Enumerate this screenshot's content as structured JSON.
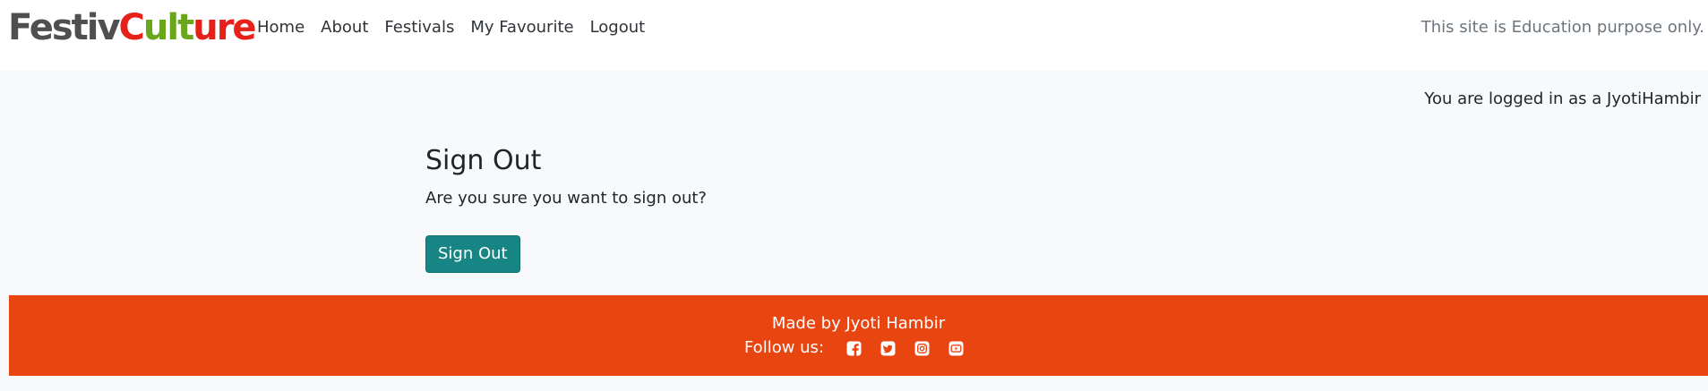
{
  "brand": {
    "part1": "Festiv",
    "part2": "C",
    "part3": "ult",
    "part4": "ure",
    "colors": {
      "dark": "#4f4f4f",
      "red": "#e8201a",
      "green": "#6aa61c"
    }
  },
  "nav": {
    "items": [
      {
        "label": "Home"
      },
      {
        "label": "About"
      },
      {
        "label": "Festivals"
      },
      {
        "label": "My Favourite"
      },
      {
        "label": "Logout"
      }
    ],
    "note": "This site is Education purpose only."
  },
  "main": {
    "logged_in_text": "You are logged in as a JyotiHambir",
    "title": "Sign Out",
    "confirm_text": "Are you sure you want to sign out?",
    "signout_button": "Sign Out",
    "button_color": "#168583"
  },
  "footer": {
    "credit": "Made by Jyoti Hambir",
    "follow_label": "Follow us:",
    "social_icons": [
      "facebook-icon",
      "twitter-icon",
      "instagram-icon",
      "youtube-icon"
    ],
    "background": "#e94511"
  }
}
